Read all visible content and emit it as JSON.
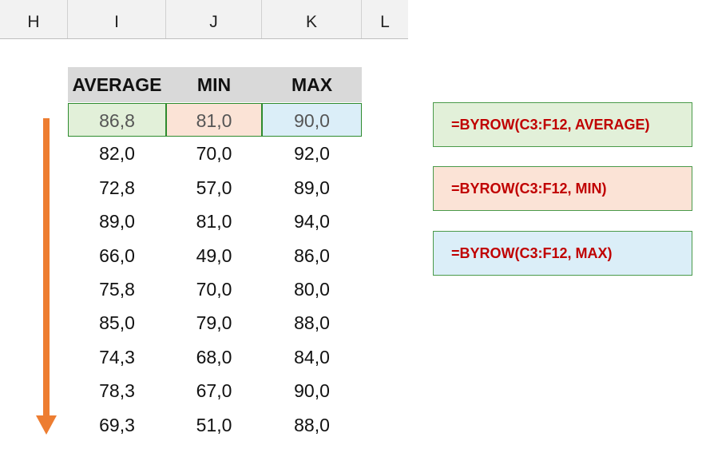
{
  "columns": [
    "H",
    "I",
    "J",
    "K",
    "L"
  ],
  "table": {
    "headers": [
      "AVERAGE",
      "MIN",
      "MAX"
    ],
    "rows": [
      [
        "86,8",
        "81,0",
        "90,0"
      ],
      [
        "82,0",
        "70,0",
        "92,0"
      ],
      [
        "72,8",
        "57,0",
        "89,0"
      ],
      [
        "89,0",
        "81,0",
        "94,0"
      ],
      [
        "66,0",
        "49,0",
        "86,0"
      ],
      [
        "75,8",
        "70,0",
        "80,0"
      ],
      [
        "85,0",
        "79,0",
        "88,0"
      ],
      [
        "74,3",
        "68,0",
        "84,0"
      ],
      [
        "78,3",
        "67,0",
        "90,0"
      ],
      [
        "69,3",
        "51,0",
        "88,0"
      ]
    ]
  },
  "formulas": {
    "average": "=BYROW(C3:F12, AVERAGE)",
    "min": "=BYROW(C3:F12, MIN)",
    "max": "=BYROW(C3:F12, MAX)"
  },
  "colors": {
    "arrow": "#ed7d31",
    "formula_text": "#c00000",
    "average_fill": "#e2f0d9",
    "min_fill": "#fbe3d6",
    "max_fill": "#dbeef8",
    "header_fill": "#d9d9d9"
  },
  "icons": [
    "down-arrow-icon"
  ]
}
